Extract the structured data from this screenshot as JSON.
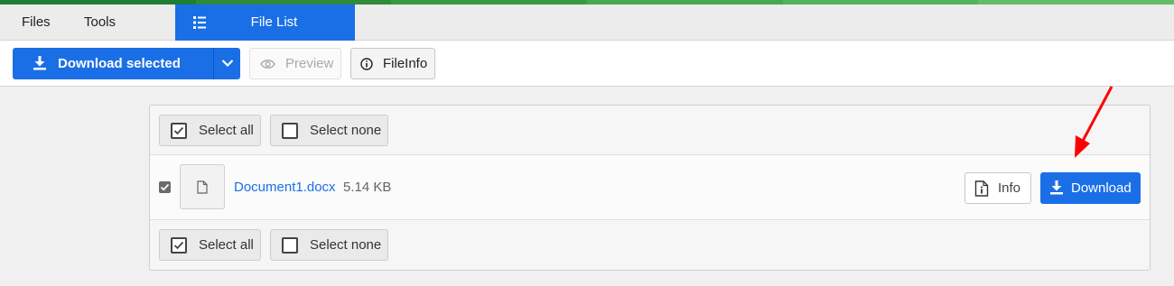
{
  "stripe_colors": [
    "#1e7e34",
    "#2e8b3a",
    "#3a9a44",
    "#48a84f",
    "#55b35b",
    "#62bd66"
  ],
  "menubar": {
    "files_label": "Files",
    "tools_label": "Tools",
    "active_tab_label": "File List",
    "active_tab_icon": "list-icon",
    "accent_color": "#1a6fe6"
  },
  "toolbar": {
    "download_selected_label": "Download selected",
    "download_selected_icon": "download-icon",
    "dropdown_icon": "chevron-down-icon",
    "preview_label": "Preview",
    "preview_icon": "eye-icon",
    "fileinfo_label": "FileInfo",
    "fileinfo_icon": "info-circle-icon"
  },
  "selection": {
    "select_all_label": "Select all",
    "select_none_label": "Select none"
  },
  "files": [
    {
      "name": "Document1.docx",
      "size": "5.14 KB",
      "checked": true,
      "info_label": "Info",
      "download_label": "Download"
    }
  ],
  "annotation": {
    "arrow_color": "#ff0000"
  }
}
